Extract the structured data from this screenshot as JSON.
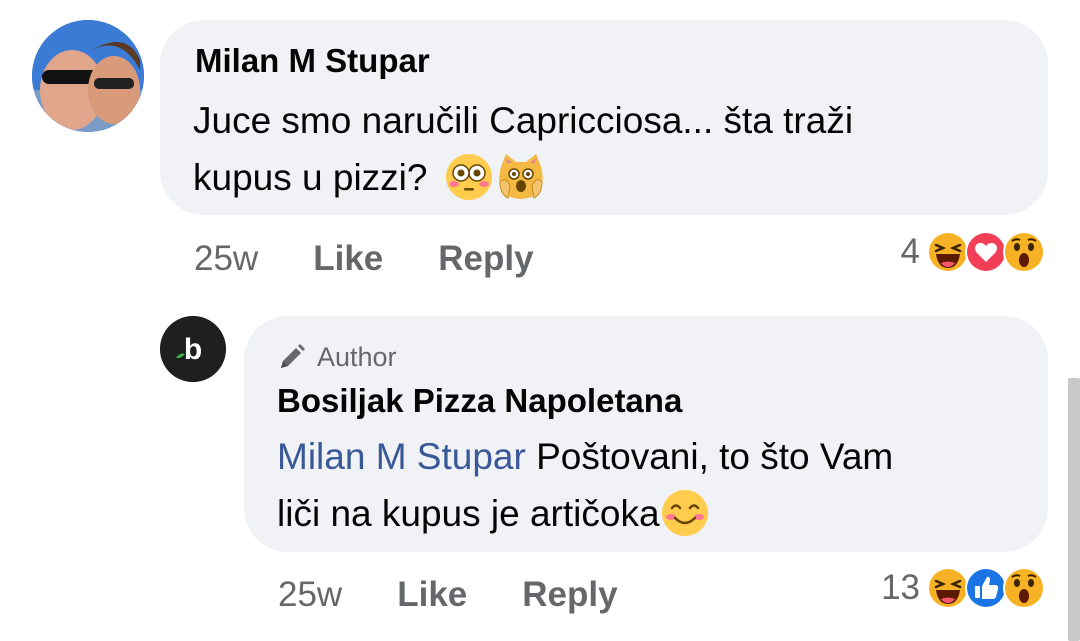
{
  "comment": {
    "author": "Milan M Stupar",
    "text_line1": "Juce smo naručili Capricciosa... šta traži",
    "text_line2": "kupus u pizzi?",
    "emojis": [
      "flushed-face-icon",
      "weary-cat-icon"
    ],
    "time": "25w",
    "like_label": "Like",
    "reply_label": "Reply",
    "reaction_count": "4",
    "reactions": [
      "haha-icon",
      "love-icon",
      "wow-icon"
    ]
  },
  "reply": {
    "badge_label": "Author",
    "author": "Bosiljak Pizza Napoletana",
    "mention": "Milan M Stupar",
    "text_line1": " Poštovani, to što Vam",
    "text_line2": "liči na kupus je artičoka",
    "emoji": "smiling-face-icon",
    "time": "25w",
    "like_label": "Like",
    "reply_label": "Reply",
    "reaction_count": "13",
    "reactions": [
      "haha-icon",
      "like-icon",
      "wow-icon"
    ]
  },
  "colors": {
    "bubble": "#f0f2f5",
    "secondary_text": "#65676b",
    "mention": "#385898"
  }
}
